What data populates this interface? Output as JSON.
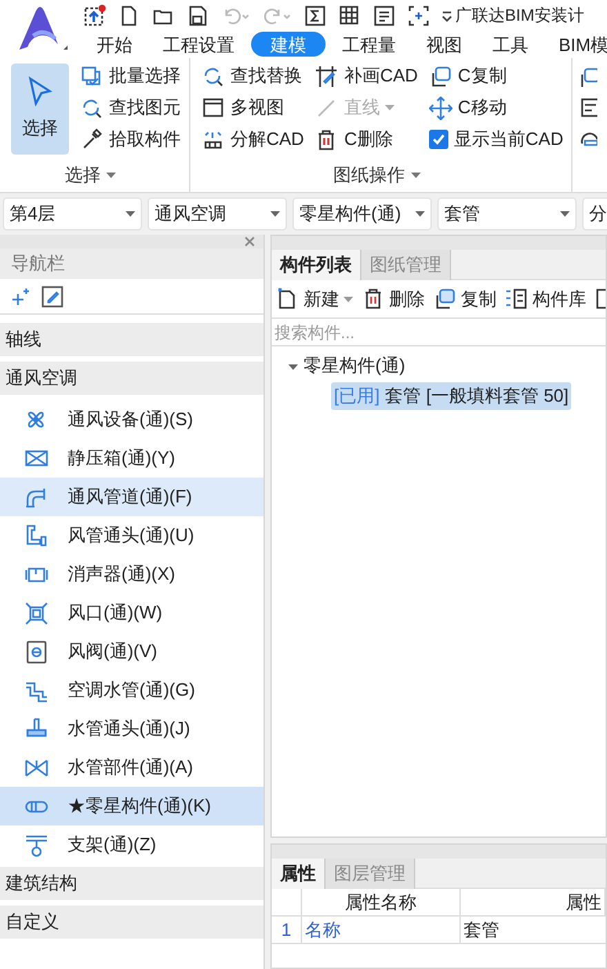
{
  "window": {
    "title": "广联达BIM安装计"
  },
  "tabs": [
    {
      "label": "开始",
      "selected": false
    },
    {
      "label": "工程设置",
      "selected": false
    },
    {
      "label": "建模",
      "selected": true
    },
    {
      "label": "工程量",
      "selected": false
    },
    {
      "label": "视图",
      "selected": false
    },
    {
      "label": "工具",
      "selected": false
    },
    {
      "label": "BIM模",
      "selected": false
    }
  ],
  "ribbon": {
    "groups": [
      {
        "label": "选择",
        "big_button": {
          "label": "选择",
          "selected": true
        },
        "columns": [
          [
            {
              "label": "批量选择",
              "kind": "button"
            },
            {
              "label": "查找图元",
              "kind": "button"
            },
            {
              "label": "拾取构件",
              "kind": "button"
            }
          ]
        ]
      },
      {
        "label": "图纸操作",
        "columns": [
          [
            {
              "label": "查找替换",
              "kind": "button"
            },
            {
              "label": "多视图",
              "kind": "button"
            },
            {
              "label": "分解CAD",
              "kind": "button"
            }
          ],
          [
            {
              "label": "补画CAD",
              "kind": "button"
            },
            {
              "label": "直线",
              "kind": "dropdown",
              "disabled": true
            },
            {
              "label": "C删除",
              "kind": "button"
            }
          ],
          [
            {
              "label": "C复制",
              "kind": "button"
            },
            {
              "label": "C移动",
              "kind": "button"
            },
            {
              "label": "显示当前CAD",
              "kind": "checkbox",
              "checked": true
            }
          ]
        ]
      }
    ]
  },
  "filters": [
    "第4层",
    "通风空调",
    "零星构件(通)",
    "套管",
    "分"
  ],
  "nav": {
    "title": "导航栏",
    "categories": [
      {
        "label": "轴线"
      },
      {
        "label": "通风空调",
        "items": [
          {
            "label": "通风设备(通)(S)",
            "selected": false,
            "hovered": false
          },
          {
            "label": "静压箱(通)(Y)",
            "selected": false,
            "hovered": false
          },
          {
            "label": "通风管道(通)(F)",
            "selected": false,
            "hovered": true
          },
          {
            "label": "风管通头(通)(U)",
            "selected": false,
            "hovered": false
          },
          {
            "label": "消声器(通)(X)",
            "selected": false,
            "hovered": false
          },
          {
            "label": "风口(通)(W)",
            "selected": false,
            "hovered": false
          },
          {
            "label": "风阀(通)(V)",
            "selected": false,
            "hovered": false
          },
          {
            "label": "空调水管(通)(G)",
            "selected": false,
            "hovered": false
          },
          {
            "label": "水管通头(通)(J)",
            "selected": false,
            "hovered": false
          },
          {
            "label": "水管部件(通)(A)",
            "selected": false,
            "hovered": false
          },
          {
            "label": "★零星构件(通)(K)",
            "selected": true,
            "hovered": false
          },
          {
            "label": "支架(通)(Z)",
            "selected": false,
            "hovered": false
          }
        ]
      },
      {
        "label": "建筑结构"
      },
      {
        "label": "自定义"
      }
    ]
  },
  "component_panel": {
    "tabs": [
      {
        "label": "构件列表",
        "selected": true
      },
      {
        "label": "图纸管理",
        "selected": false
      }
    ],
    "toolbar": [
      "新建",
      "删除",
      "复制",
      "构件库"
    ],
    "search": {
      "placeholder": "搜索构件..."
    },
    "tree": {
      "label": "零星构件(通)",
      "expanded": true,
      "children": [
        {
          "tag": "[已用]",
          "label": "套管 [一般填料套管 50]",
          "selected": true
        }
      ]
    }
  },
  "properties_panel": {
    "tabs": [
      {
        "label": "属性",
        "selected": true
      },
      {
        "label": "图层管理",
        "selected": false
      }
    ],
    "columns": [
      "属性名称",
      "属性"
    ],
    "rows": [
      {
        "index": "1",
        "name": "名称",
        "value": "套管"
      }
    ]
  }
}
